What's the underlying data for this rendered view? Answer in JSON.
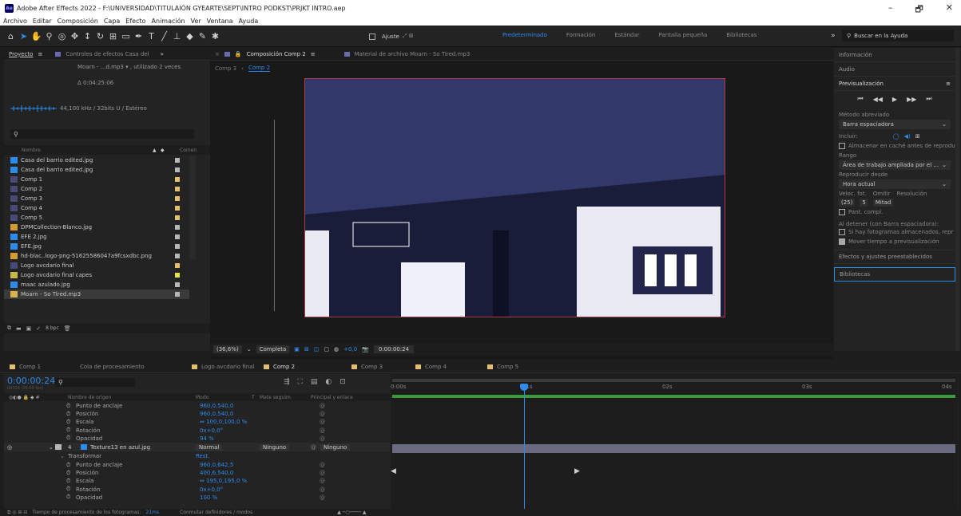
{
  "window": {
    "title": "Adobe After Effects 2022 - F:\\UNIVERSIDAD\\TITULAIÓN GYEARTE\\SEPT\\INTRO PODKST\\PRJKT INTRO.aep",
    "app_badge": "Ae",
    "minimize": "–",
    "maximize": "🗗",
    "close": "✕"
  },
  "menu": [
    "Archivo",
    "Editar",
    "Composición",
    "Capa",
    "Efecto",
    "Animación",
    "Ver",
    "Ventana",
    "Ayuda"
  ],
  "toolbar": {
    "snap_label": "Ajuste",
    "workspaces": [
      "Predeterminado",
      "Formación",
      "Estándar",
      "Pantalla pequeña",
      "Bibliotecas"
    ],
    "active_workspace": "Predeterminado",
    "search_placeholder": "Buscar en la Ayuda",
    "more": "»"
  },
  "project": {
    "tab": "Proyecto",
    "effects_tab": "Controles de efectos Casa del",
    "more": "»",
    "file_name": "Moarn - ...d.mp3 ▾ , utilizado 2 veces",
    "duration": "Δ 0:04:25:06",
    "audio_info": "44,100 kHz / 32bits U / Estéreo",
    "search_placeholder": "",
    "col_name": "Nombre",
    "col_comment": "Comen",
    "items": [
      {
        "name": "Casa del barrio edited.jpg",
        "type": "img",
        "color": "#b7b7b7"
      },
      {
        "name": "Casa del barrio edited.jpg",
        "type": "img",
        "color": "#b7b7b7"
      },
      {
        "name": "Comp 1",
        "type": "comp",
        "color": "#e5c06b"
      },
      {
        "name": "Comp 2",
        "type": "comp",
        "color": "#e5c06b"
      },
      {
        "name": "Comp 3",
        "type": "comp",
        "color": "#e5c06b"
      },
      {
        "name": "Comp 4",
        "type": "comp",
        "color": "#e5c06b"
      },
      {
        "name": "Comp 5",
        "type": "comp",
        "color": "#e5c06b"
      },
      {
        "name": "DPMCollection-Blanco.jpg",
        "type": "ai",
        "color": "#b7b7b7"
      },
      {
        "name": "EFE 2.jpg",
        "type": "img",
        "color": "#b7b7b7"
      },
      {
        "name": "EFE.jpg",
        "type": "img",
        "color": "#b7b7b7"
      },
      {
        "name": "hd-blac..logo-png-51625586047a9fcsxdbc.png",
        "type": "ai",
        "color": "#b7b7b7"
      },
      {
        "name": "Logo avcdario final",
        "type": "comp",
        "color": "#e5c06b"
      },
      {
        "name": "Logo avcdario final capes",
        "type": "folder",
        "color": "#e8e14a"
      },
      {
        "name": "maac azulado.jpg",
        "type": "img",
        "color": "#b7b7b7"
      },
      {
        "name": "Moarn - So Tired.mp3",
        "type": "audio",
        "color": "#b7b7b7"
      }
    ],
    "footer_bpc": "8 bpc"
  },
  "composition": {
    "tab": "Composición Comp 2",
    "footage_tab": "Material de archivo Moarn - So Tired.mp3",
    "breadcrumb_prev": "Comp 3",
    "breadcrumb_curr": "Comp 2",
    "zoom": "(36,6%)",
    "resolution": "Completa",
    "exposure": "+0,0",
    "timecode": "0:00:00:24"
  },
  "right": {
    "info": "Información",
    "audio": "Audio",
    "preview": "Previsualización",
    "shortcut_label": "Método abreviado",
    "shortcut_value": "Barra espaciadora",
    "include_label": "Incluir:",
    "cache_label": "Almacenar en caché antes de reprodu",
    "range_label": "Rango",
    "range_value": "Área de trabajo ampliada por el ...",
    "play_from_label": "Reproducir desde",
    "play_from_value": "Hora actual",
    "fps_label": "Veloc. fot.",
    "skip_label": "Omitir",
    "res_label": "Resolución",
    "fps_value": "(25)",
    "skip_value": "5",
    "res_value": "Mitad",
    "fullscreen_label": "Pant. compl.",
    "on_stop_label": "Al detener (con Barra espaciadora):",
    "cached_label": "Si hay fotogramas almacenados, repr",
    "move_time_label": "Mover tiempo a previsualización",
    "effects_presets": "Efectos y ajustes preestablecidos",
    "libraries": "Bibliotecas"
  },
  "timeline": {
    "tabs": [
      "Comp 1",
      "Cola de procesamiento",
      "Logo avcdario final",
      "Comp 2",
      "Comp 3",
      "Comp 4",
      "Comp 5"
    ],
    "active_tab": "Comp 2",
    "tab_colors": [
      "#e5c06b",
      "",
      "#e5c06b",
      "#e5c06b",
      "#e5c06b",
      "#e5c06b",
      "#e5c06b"
    ],
    "timecode": "0:00:00:24",
    "timecode_sub": "00024 (25.00 fps)",
    "search_placeholder": "",
    "col_source": "Nombre de origen",
    "col_mode": "Modo",
    "col_t": "T",
    "col_matte": "Mate seguim.",
    "col_parent": "Principal y enlace",
    "ruler": [
      "0:00s",
      "01s",
      "02s",
      "03s",
      "04s"
    ],
    "props_top": [
      {
        "name": "Punto de anclaje",
        "value": "960,0,540,0"
      },
      {
        "name": "Posición",
        "value": "960,0,540,0"
      },
      {
        "name": "Escala",
        "value": "⇔ 100,0,100,0 %"
      },
      {
        "name": "Rotación",
        "value": "0x+0,0°"
      },
      {
        "name": "Opacidad",
        "value": "94 %"
      }
    ],
    "layer": {
      "num": "4",
      "name": "Texture13 en azul.jpg",
      "mode": "Normal",
      "matte": "Ninguno",
      "parent": "Ninguno"
    },
    "transform_label": "Transformar",
    "reset_label": "Rest.",
    "props_bottom": [
      {
        "name": "Punto de anclaje",
        "value": "960,0,642,5"
      },
      {
        "name": "Posición",
        "value": "400,6,540,0"
      },
      {
        "name": "Escala",
        "value": "⇔ 195,0,195,0 %"
      },
      {
        "name": "Rotación",
        "value": "0x+0,0°"
      },
      {
        "name": "Opacidad",
        "value": "100 %"
      }
    ],
    "footer_render": "Tiempo de procesamiento de los fotogramas:",
    "footer_render_value": "21ms",
    "footer_toggle": "Conmutar definidores / modos"
  }
}
